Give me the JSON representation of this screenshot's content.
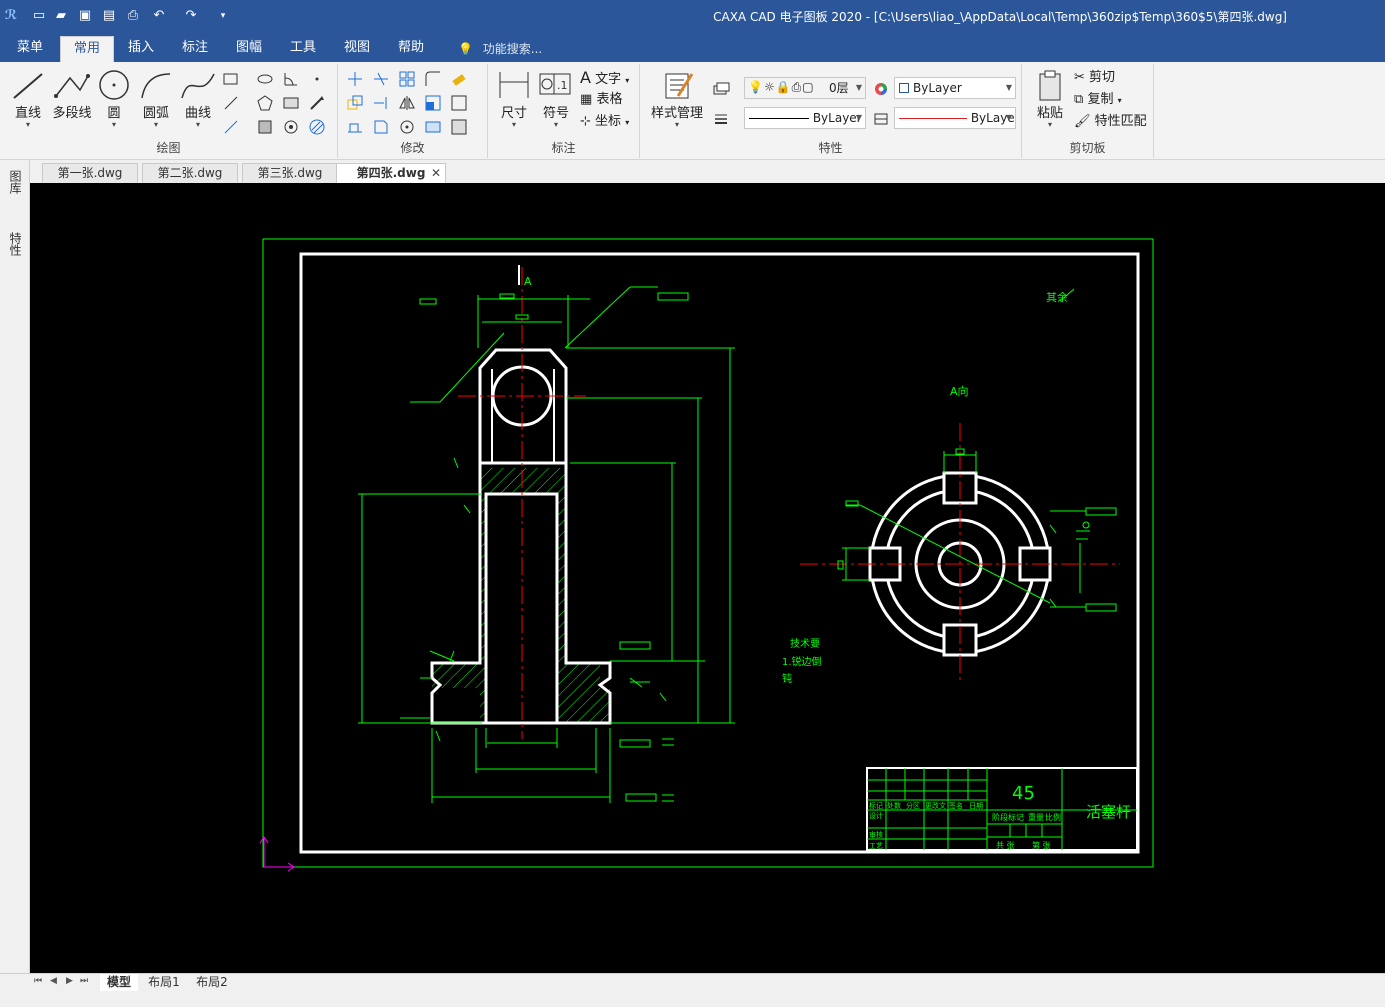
{
  "window": {
    "title": "CAXA CAD 电子图板 2020 - [C:\\Users\\liao_\\AppData\\Local\\Temp\\360zip$Temp\\360$5\\第四张.dwg]",
    "app_icon": "caxa-logo-icon",
    "accent": "#2b579a"
  },
  "quick_access": [
    "new-file-icon",
    "open-folder-icon",
    "save-icon",
    "save-as-icon",
    "print-icon",
    "undo-icon",
    "redo-icon",
    "customize-icon"
  ],
  "menu": {
    "tabs": [
      "菜单",
      "常用",
      "插入",
      "标注",
      "图幅",
      "工具",
      "视图",
      "帮助"
    ],
    "active": "常用",
    "search": "功能搜索..."
  },
  "ribbon": {
    "draw": {
      "label": "绘图",
      "buttons": [
        "直线",
        "多段线",
        "圆",
        "圆弧",
        "曲线"
      ]
    },
    "modify": {
      "label": "修改"
    },
    "annotate": {
      "label": "标注",
      "buttons": [
        "尺寸",
        "符号"
      ],
      "small": [
        "文字",
        "表格",
        "坐标"
      ]
    },
    "props": {
      "label": "特性",
      "style_manager": "样式管理",
      "layer": "0层",
      "color": "ByLayer",
      "linetype": "ByLayer",
      "lineweight": "ByLaye"
    },
    "clipboard": {
      "label": "剪切板",
      "paste": "粘贴",
      "small": [
        "剪切",
        "复制",
        "特性匹配"
      ]
    }
  },
  "doc_tabs": [
    "第一张.dwg",
    "第二张.dwg",
    "第三张.dwg",
    "第四张.dwg"
  ],
  "active_doc": "第四张.dwg",
  "side_panels": [
    "图库",
    "特性"
  ],
  "layout_tabs": [
    "模型",
    "布局1",
    "布局2"
  ],
  "active_layout": "模型",
  "drawing": {
    "view_a": "A",
    "view_label": "A向",
    "surface_note": "其余",
    "tech_note_line1": "技术要",
    "tech_note_line2": "1.锐边倒",
    "tech_note_line3": "钝",
    "material": "45",
    "part_name": "活塞杆",
    "tb_row1": [
      "标记",
      "处数",
      "分区",
      "更改文",
      "签名",
      "日期"
    ],
    "tb_design": "设计",
    "tb_review": "审核",
    "tb_craft": "工艺",
    "tb_stage": "阶段标记",
    "tb_weight": "重量",
    "tb_scale": "比例",
    "tb_total": "共 张",
    "tb_sheet": "第 张",
    "colors": {
      "frame": "#ffffff",
      "dim": "#00ff00",
      "center": "#ff0000",
      "axis": "#ff00ff",
      "hatch": "#00ff00"
    }
  }
}
